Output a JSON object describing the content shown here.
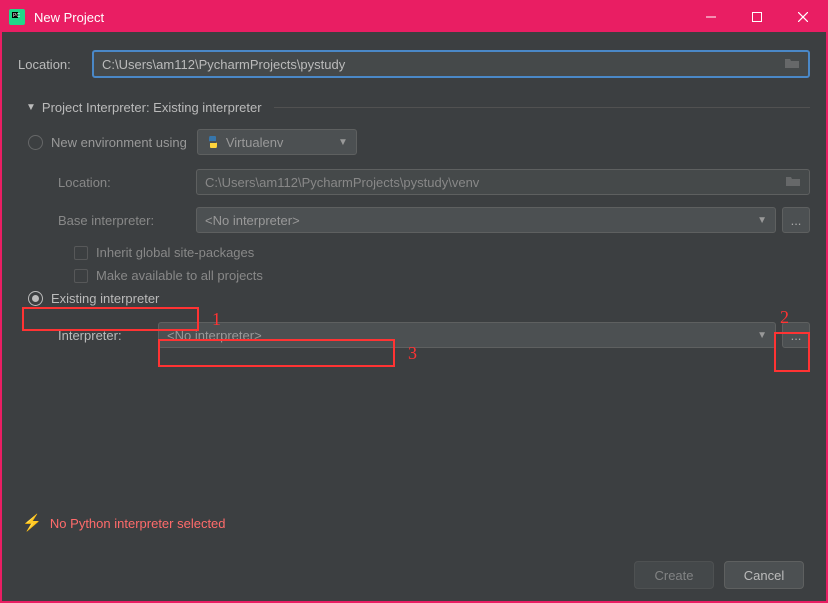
{
  "window": {
    "title": "New Project"
  },
  "main": {
    "location_label": "Location:",
    "location_value": "C:\\Users\\am112\\PycharmProjects\\pystudy"
  },
  "section": {
    "header": "Project Interpreter: Existing interpreter"
  },
  "env": {
    "new_label": "New environment using",
    "tool": "Virtualenv",
    "loc_label": "Location:",
    "loc_value": "C:\\Users\\am112\\PycharmProjects\\pystudy\\venv",
    "base_label": "Base interpreter:",
    "base_value": "<No interpreter>",
    "inherit": "Inherit global site-packages",
    "make_avail": "Make available to all projects"
  },
  "existing": {
    "label": "Existing interpreter",
    "interp_label": "Interpreter:",
    "interp_value": "<No interpreter>"
  },
  "annotations": {
    "n1": "1",
    "n2": "2",
    "n3": "3"
  },
  "warning": "No Python interpreter selected",
  "buttons": {
    "create": "Create",
    "cancel": "Cancel"
  },
  "browse": "..."
}
